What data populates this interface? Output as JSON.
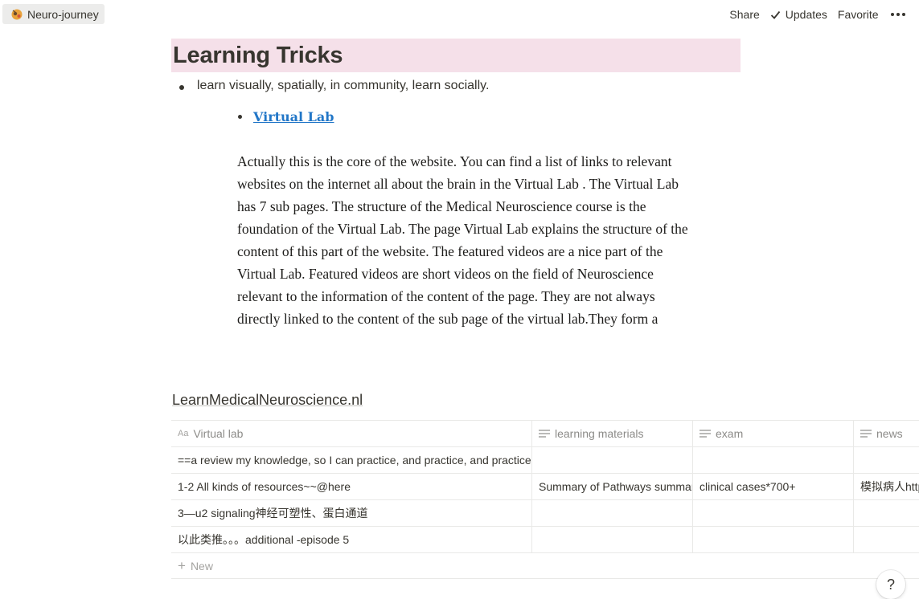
{
  "topbar": {
    "breadcrumb": "Neuro-journey",
    "share": "Share",
    "updates": "Updates",
    "favorite": "Favorite"
  },
  "page": {
    "heading": "Learning Tricks",
    "bullet": "learn visually, spatially, in community, learn socially.",
    "sub_bullet_link": "Virtual Lab",
    "paragraph": "Actually this is the core of the website. You can find a list of links to relevant websites on the internet all about the brain in the Virtual Lab . The Virtual Lab has 7 sub pages. The structure of the  Medical Neuroscience course is the foundation of the Virtual Lab.  The page Virtual Lab explains the structure of the content of this part of the website. The featured videos are a nice part of the Virtual Lab. Featured videos are  short videos on the field of Neuroscience relevant to the information of the content of the page. They are not always directly linked to the content of the sub page of the virtual lab.They form a"
  },
  "table": {
    "title": "LearnMedicalNeuroscience.nl",
    "columns": [
      "Virtual lab",
      "learning materials",
      "exam",
      "news"
    ],
    "rows": [
      [
        "==a review my knowledge, so I can practice, and practice, and practice",
        "",
        "",
        ""
      ],
      [
        "1-2 All kinds of resources~~@here",
        "Summary of Pathways summary",
        "clinical cases*700+",
        "模拟病人http"
      ],
      [
        "3—u2 signaling神经可塑性、蛋白通道",
        "",
        "",
        ""
      ],
      [
        "以此类推。。。additional -episode 5",
        "",
        "",
        ""
      ]
    ],
    "new_label": "New"
  },
  "help": "?"
}
